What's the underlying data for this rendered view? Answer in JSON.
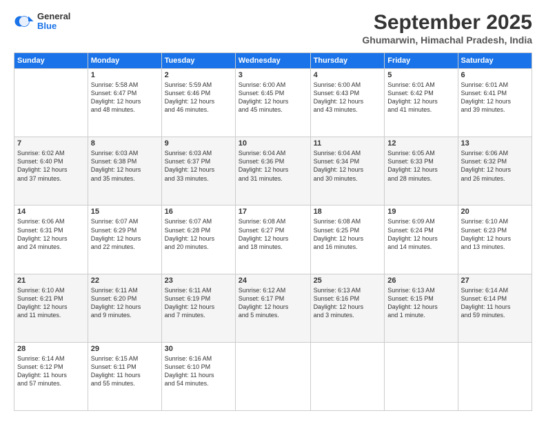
{
  "header": {
    "logo_general": "General",
    "logo_blue": "Blue",
    "month": "September 2025",
    "location": "Ghumarwin, Himachal Pradesh, India"
  },
  "days_of_week": [
    "Sunday",
    "Monday",
    "Tuesday",
    "Wednesday",
    "Thursday",
    "Friday",
    "Saturday"
  ],
  "weeks": [
    [
      {
        "day": "",
        "info": ""
      },
      {
        "day": "1",
        "info": "Sunrise: 5:58 AM\nSunset: 6:47 PM\nDaylight: 12 hours\nand 48 minutes."
      },
      {
        "day": "2",
        "info": "Sunrise: 5:59 AM\nSunset: 6:46 PM\nDaylight: 12 hours\nand 46 minutes."
      },
      {
        "day": "3",
        "info": "Sunrise: 6:00 AM\nSunset: 6:45 PM\nDaylight: 12 hours\nand 45 minutes."
      },
      {
        "day": "4",
        "info": "Sunrise: 6:00 AM\nSunset: 6:43 PM\nDaylight: 12 hours\nand 43 minutes."
      },
      {
        "day": "5",
        "info": "Sunrise: 6:01 AM\nSunset: 6:42 PM\nDaylight: 12 hours\nand 41 minutes."
      },
      {
        "day": "6",
        "info": "Sunrise: 6:01 AM\nSunset: 6:41 PM\nDaylight: 12 hours\nand 39 minutes."
      }
    ],
    [
      {
        "day": "7",
        "info": "Sunrise: 6:02 AM\nSunset: 6:40 PM\nDaylight: 12 hours\nand 37 minutes."
      },
      {
        "day": "8",
        "info": "Sunrise: 6:03 AM\nSunset: 6:38 PM\nDaylight: 12 hours\nand 35 minutes."
      },
      {
        "day": "9",
        "info": "Sunrise: 6:03 AM\nSunset: 6:37 PM\nDaylight: 12 hours\nand 33 minutes."
      },
      {
        "day": "10",
        "info": "Sunrise: 6:04 AM\nSunset: 6:36 PM\nDaylight: 12 hours\nand 31 minutes."
      },
      {
        "day": "11",
        "info": "Sunrise: 6:04 AM\nSunset: 6:34 PM\nDaylight: 12 hours\nand 30 minutes."
      },
      {
        "day": "12",
        "info": "Sunrise: 6:05 AM\nSunset: 6:33 PM\nDaylight: 12 hours\nand 28 minutes."
      },
      {
        "day": "13",
        "info": "Sunrise: 6:06 AM\nSunset: 6:32 PM\nDaylight: 12 hours\nand 26 minutes."
      }
    ],
    [
      {
        "day": "14",
        "info": "Sunrise: 6:06 AM\nSunset: 6:31 PM\nDaylight: 12 hours\nand 24 minutes."
      },
      {
        "day": "15",
        "info": "Sunrise: 6:07 AM\nSunset: 6:29 PM\nDaylight: 12 hours\nand 22 minutes."
      },
      {
        "day": "16",
        "info": "Sunrise: 6:07 AM\nSunset: 6:28 PM\nDaylight: 12 hours\nand 20 minutes."
      },
      {
        "day": "17",
        "info": "Sunrise: 6:08 AM\nSunset: 6:27 PM\nDaylight: 12 hours\nand 18 minutes."
      },
      {
        "day": "18",
        "info": "Sunrise: 6:08 AM\nSunset: 6:25 PM\nDaylight: 12 hours\nand 16 minutes."
      },
      {
        "day": "19",
        "info": "Sunrise: 6:09 AM\nSunset: 6:24 PM\nDaylight: 12 hours\nand 14 minutes."
      },
      {
        "day": "20",
        "info": "Sunrise: 6:10 AM\nSunset: 6:23 PM\nDaylight: 12 hours\nand 13 minutes."
      }
    ],
    [
      {
        "day": "21",
        "info": "Sunrise: 6:10 AM\nSunset: 6:21 PM\nDaylight: 12 hours\nand 11 minutes."
      },
      {
        "day": "22",
        "info": "Sunrise: 6:11 AM\nSunset: 6:20 PM\nDaylight: 12 hours\nand 9 minutes."
      },
      {
        "day": "23",
        "info": "Sunrise: 6:11 AM\nSunset: 6:19 PM\nDaylight: 12 hours\nand 7 minutes."
      },
      {
        "day": "24",
        "info": "Sunrise: 6:12 AM\nSunset: 6:17 PM\nDaylight: 12 hours\nand 5 minutes."
      },
      {
        "day": "25",
        "info": "Sunrise: 6:13 AM\nSunset: 6:16 PM\nDaylight: 12 hours\nand 3 minutes."
      },
      {
        "day": "26",
        "info": "Sunrise: 6:13 AM\nSunset: 6:15 PM\nDaylight: 12 hours\nand 1 minute."
      },
      {
        "day": "27",
        "info": "Sunrise: 6:14 AM\nSunset: 6:14 PM\nDaylight: 11 hours\nand 59 minutes."
      }
    ],
    [
      {
        "day": "28",
        "info": "Sunrise: 6:14 AM\nSunset: 6:12 PM\nDaylight: 11 hours\nand 57 minutes."
      },
      {
        "day": "29",
        "info": "Sunrise: 6:15 AM\nSunset: 6:11 PM\nDaylight: 11 hours\nand 55 minutes."
      },
      {
        "day": "30",
        "info": "Sunrise: 6:16 AM\nSunset: 6:10 PM\nDaylight: 11 hours\nand 54 minutes."
      },
      {
        "day": "",
        "info": ""
      },
      {
        "day": "",
        "info": ""
      },
      {
        "day": "",
        "info": ""
      },
      {
        "day": "",
        "info": ""
      }
    ]
  ]
}
